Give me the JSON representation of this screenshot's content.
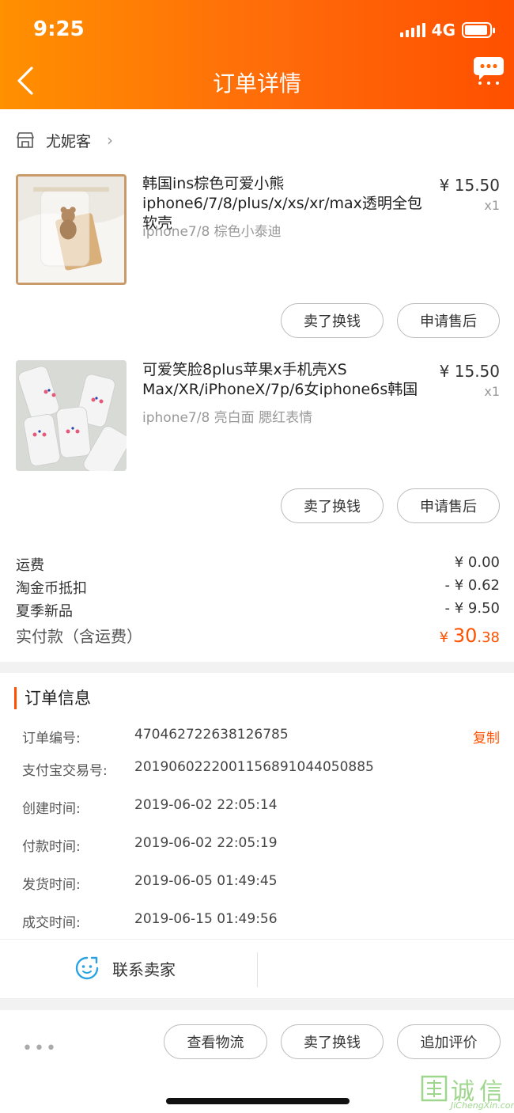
{
  "status_bar": {
    "time": "9:25",
    "network": "4G"
  },
  "header": {
    "title": "订单详情"
  },
  "shop": {
    "name": "尤妮客"
  },
  "items": [
    {
      "title": "韩国ins棕色可爱小熊iphone6/7/8/plus/x/xs/xr/max透明全包软壳",
      "sku": "iphone7/8 棕色小泰迪",
      "price": "¥ 15.50",
      "qty": "x1",
      "btn_sell": "卖了换钱",
      "btn_aftersale": "申请售后"
    },
    {
      "title": "可爱笑脸8plus苹果x手机壳XS Max/XR/iPhoneX/7p/6女iphone6s韩国",
      "sku": "iphone7/8 亮白面 腮红表情",
      "price": "¥ 15.50",
      "qty": "x1",
      "btn_sell": "卖了换钱",
      "btn_aftersale": "申请售后"
    }
  ],
  "fees": [
    {
      "label": "运费",
      "value": "¥ 0.00"
    },
    {
      "label": "淘金币抵扣",
      "value": "- ¥ 0.62"
    },
    {
      "label": "夏季新品",
      "value": "- ¥ 9.50"
    }
  ],
  "total": {
    "label": "实付款（含运费）",
    "currency": "¥ ",
    "int": "30",
    "dec": ".38"
  },
  "order_info": {
    "title": "订单信息",
    "copy_label": "复制",
    "rows": [
      {
        "label": "订单编号:",
        "value": "470462722638126785"
      },
      {
        "label": "支付宝交易号:",
        "value": "2019060222001156891044050885"
      },
      {
        "label": "创建时间:",
        "value": "2019-06-02 22:05:14"
      },
      {
        "label": "付款时间:",
        "value": "2019-06-02 22:05:19"
      },
      {
        "label": "发货时间:",
        "value": "2019-06-05 01:49:45"
      },
      {
        "label": "成交时间:",
        "value": "2019-06-15 01:49:56"
      }
    ]
  },
  "contact": {
    "label": "联系卖家"
  },
  "bottom_bar": {
    "more": "•••",
    "logistics": "查看物流",
    "sell": "卖了换钱",
    "review": "追加评价"
  },
  "watermark": {
    "text": "诚信",
    "url": "JiChengXin.com"
  },
  "colors": {
    "accent": "#ff5000",
    "header_start": "#ff9000"
  }
}
